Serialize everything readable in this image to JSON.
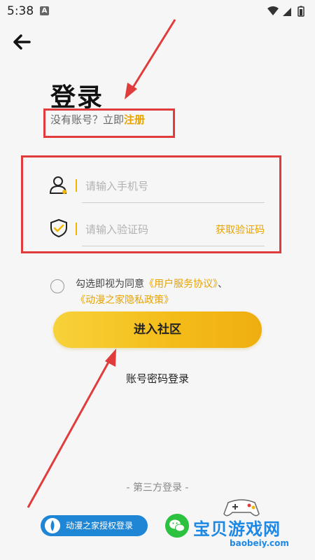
{
  "status_bar": {
    "time": "5:38",
    "badge": "A"
  },
  "header": {
    "title": "登录"
  },
  "register": {
    "prefix": "没有账号？立即",
    "link": "注册"
  },
  "form": {
    "phone_placeholder": "请输入手机号",
    "code_placeholder": "请输入验证码",
    "get_code": "获取验证码"
  },
  "agreement": {
    "prefix": "勾选即视为同意",
    "link1": "《用户服务协议》",
    "sep": "、",
    "link2": "《动漫之家隐私政策》"
  },
  "actions": {
    "enter": "进入社区",
    "password_login": "账号密码登录"
  },
  "third_party": {
    "label": "- 第三方登录 -",
    "auth_button": "动漫之家授权登录"
  },
  "watermark": {
    "text": "宝贝游戏网",
    "url": "baobeiy.com"
  },
  "colors": {
    "accent": "#e8a300",
    "button": "#f4bd1a",
    "annotation": "#e03c3c"
  }
}
